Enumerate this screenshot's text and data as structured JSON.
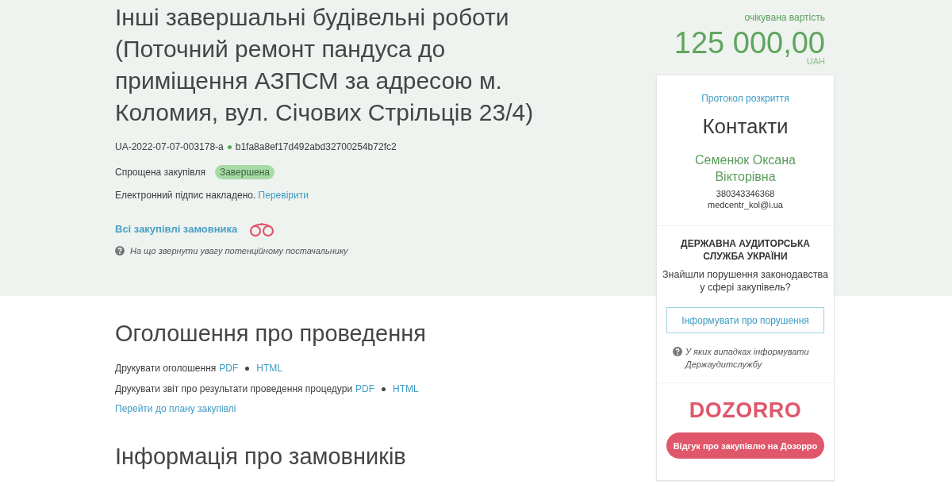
{
  "tender": {
    "title": "Інші завершальні будівельні роботи (Поточний ремонт пандуса до приміщення АЗПСМ за адресою м. Коломия, вул. Січових Стрільців 23/4)",
    "id": "UA-2022-07-07-003178-a",
    "hash": "b1fa8a8ef17d492abd32700254b72fc2",
    "procedure_type": "Спрощена закупівля",
    "status": "Завершена",
    "signature": {
      "text": "Електронний підпис накладено.",
      "link": "Перевірити"
    },
    "all_purchases_link": "Всі закупівлі замовника",
    "supplier_hint": "На що звернути увагу потенційному постачальнику"
  },
  "announcement": {
    "heading": "Оголошення про проведення",
    "print_rows": [
      {
        "label": "Друкувати оголошення",
        "links": [
          "PDF",
          "HTML"
        ]
      },
      {
        "label": "Друкувати звіт про результати проведення процедури",
        "links": [
          "PDF",
          "HTML"
        ]
      }
    ],
    "plan_link": "Перейти до плану закупівлі"
  },
  "customers": {
    "heading": "Інформація про замовників"
  },
  "price": {
    "caption": "очікувана вартість",
    "amount": "125 000,00",
    "currency": "UAH"
  },
  "sidebar": {
    "protocol_link": "Протокол розкриття",
    "contacts": {
      "heading": "Контакти",
      "name": "Семенюк Оксана Вікторівна",
      "phone": "380343346368",
      "email": "medcentr_kol@i.ua"
    },
    "audit": {
      "title": "ДЕРЖАВНА АУДИТОРСЬКА СЛУЖБА УКРАЇНИ",
      "question": "Знайшли порушення законодавства у сфері закупівель?",
      "report_button": "Інформувати про порушення",
      "hint": "У яких випадках інформувати Держаудитслужбу"
    },
    "dozorro": {
      "logo": "DOZORRO",
      "feedback_button": "Відгук про закупівлю на Дозорро"
    }
  }
}
